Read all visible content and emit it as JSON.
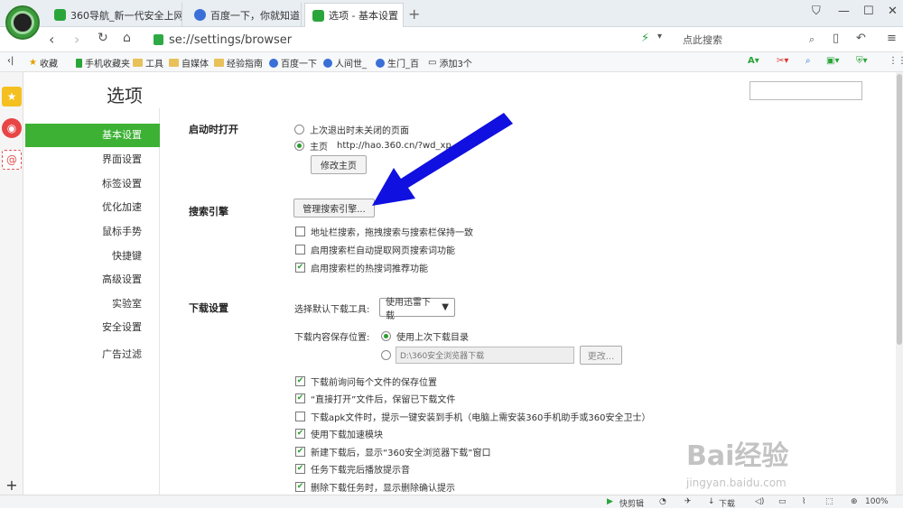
{
  "tabs": [
    {
      "label": "360导航_新一代安全上网",
      "color": "#2aa53a"
    },
    {
      "label": "百度一下，你就知道",
      "color": "#3a6fd8"
    },
    {
      "label": "选项 - 基本设置",
      "color": "#2aa53a"
    }
  ],
  "address": {
    "url": "se://settings/browser",
    "search_placeholder": "点此搜索"
  },
  "bookmarks": [
    "收藏",
    "手机收藏夹",
    "工具",
    "自媒体",
    "经验指南",
    "百度一下",
    "人间世_",
    "生门_百",
    "添加3个"
  ],
  "page_title": "选项",
  "nav": [
    "基本设置",
    "界面设置",
    "标签设置",
    "优化加速",
    "鼠标手势",
    "快捷键",
    "高级设置",
    "实验室",
    "安全设置",
    "广告过滤"
  ],
  "startup": {
    "heading": "启动时打开",
    "option1": "上次退出时未关闭的页面",
    "option2_label": "主页",
    "option2_url": "http://hao.360.cn/?wd_xp",
    "change_btn": "修改主页"
  },
  "search": {
    "heading": "搜索引擎",
    "manage_btn": "管理搜索引擎...",
    "options": [
      {
        "label": "地址栏搜索，拖拽搜索与搜索栏保持一致",
        "checked": false
      },
      {
        "label": "启用搜索栏自动提取网页搜索词功能",
        "checked": false
      },
      {
        "label": "启用搜索栏的热搜词推荐功能",
        "checked": true
      }
    ]
  },
  "download": {
    "heading": "下载设置",
    "tool_label": "选择默认下载工具:",
    "tool_value": "使用迅雷下载",
    "path_label": "下载内容保存位置:",
    "use_last": "使用上次下载目录",
    "path_value": "D:\\360安全浏览器下载",
    "change_btn": "更改...",
    "options": [
      {
        "label": "下载前询问每个文件的保存位置",
        "checked": true
      },
      {
        "label": "“直接打开”文件后，保留已下载文件",
        "checked": true
      },
      {
        "label": "下载apk文件时，提示一键安装到手机（电脑上需安装360手机助手或360安全卫士）",
        "checked": false
      },
      {
        "label": "使用下载加速模块",
        "checked": true
      },
      {
        "label": "新建下载后，显示“360安全浏览器下载”窗口",
        "checked": true
      },
      {
        "label": "任务下载完后播放提示音",
        "checked": true
      },
      {
        "label": "删除下载任务时，显示删除确认提示",
        "checked": true
      }
    ]
  },
  "statusbar": {
    "clip": "快剪辑",
    "download": "下载",
    "zoom": "100%"
  },
  "watermark": {
    "brand": "Bai经验",
    "url": "jingyan.baidu.com"
  },
  "colors": {
    "accent": "#3db134",
    "arrow": "#1010e0"
  }
}
